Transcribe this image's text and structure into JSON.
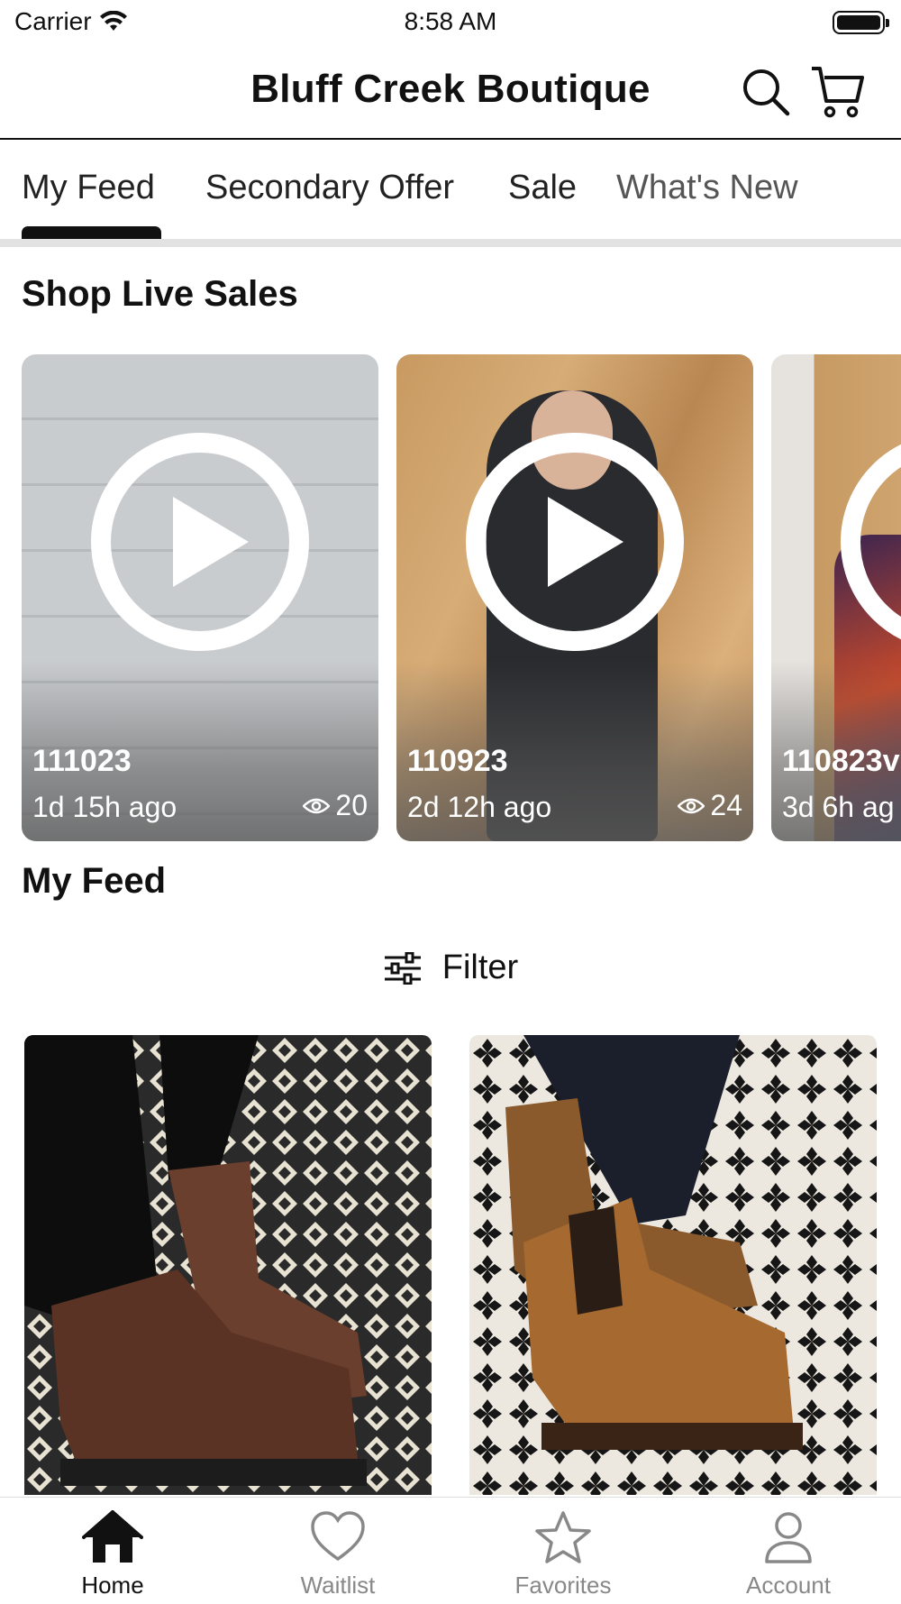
{
  "status_bar": {
    "carrier": "Carrier",
    "time": "8:58 AM"
  },
  "header": {
    "title": "Bluff Creek Boutique",
    "icons": [
      "search-icon",
      "cart-icon"
    ]
  },
  "tabs": [
    {
      "label": "My Feed",
      "active": true
    },
    {
      "label": "Secondary Offer",
      "active": false
    },
    {
      "label": "Sale",
      "active": false
    },
    {
      "label": "What's New",
      "active": false
    }
  ],
  "live_section": {
    "heading": "Shop Live Sales",
    "cards": [
      {
        "title": "111023",
        "ago": "1d 15h ago",
        "views": "20"
      },
      {
        "title": "110923",
        "ago": "2d 12h ago",
        "views": "24"
      },
      {
        "title": "110823v",
        "ago": "3d 6h ag",
        "views": ""
      }
    ]
  },
  "feed": {
    "heading": "My Feed",
    "filter_label": "Filter"
  },
  "bottom_nav": [
    {
      "label": "Home",
      "icon": "home-icon",
      "active": true
    },
    {
      "label": "Waitlist",
      "icon": "heart-icon",
      "active": false
    },
    {
      "label": "Favorites",
      "icon": "star-icon",
      "active": false
    },
    {
      "label": "Account",
      "icon": "person-icon",
      "active": false
    }
  ],
  "colors": {
    "text": "#111111",
    "inactive": "#888888",
    "divider": "#e2e2e2"
  }
}
